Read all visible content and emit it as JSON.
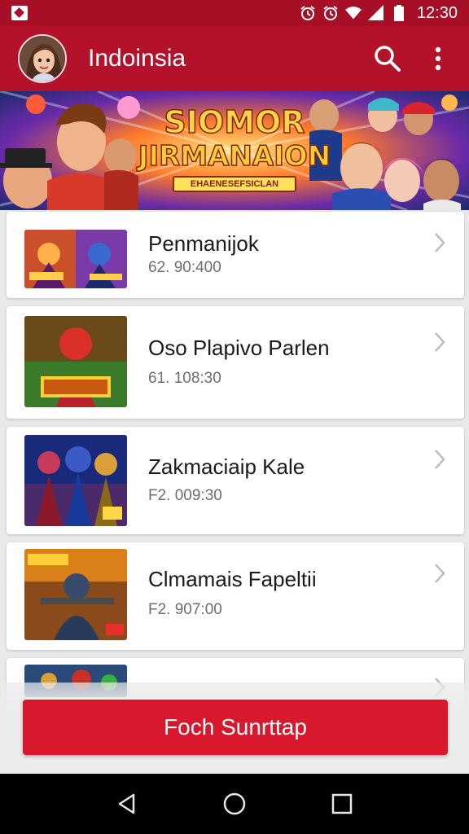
{
  "status_bar": {
    "time": "12:30",
    "icons": [
      "alarm-icon",
      "alarm-icon",
      "wifi-icon",
      "signal-icon",
      "battery-icon"
    ]
  },
  "app_bar": {
    "title": "Indoinsia",
    "actions": [
      "search-icon",
      "more-vert-icon"
    ]
  },
  "banner": {
    "line1": "SIOMOR",
    "line2": "JIRMANAION",
    "line3": "EHAENESEFSICLAN"
  },
  "items": [
    {
      "title": "Penmanijok",
      "subtitle": "62. 90:400"
    },
    {
      "title": "Oso Plapivo Parlen",
      "subtitle": "61. 108:30"
    },
    {
      "title": "Zakmaciaip Kale",
      "subtitle": "F2. 009:30"
    },
    {
      "title": "Clmamais Fapeltii",
      "subtitle": "F2. 907:00"
    }
  ],
  "cta": {
    "label": "Foch Sunrttap"
  },
  "nav": [
    "back-icon",
    "home-icon",
    "recents-icon"
  ],
  "colors": {
    "primary": "#b4122a",
    "status": "#a60f26",
    "cta": "#d8182c"
  }
}
